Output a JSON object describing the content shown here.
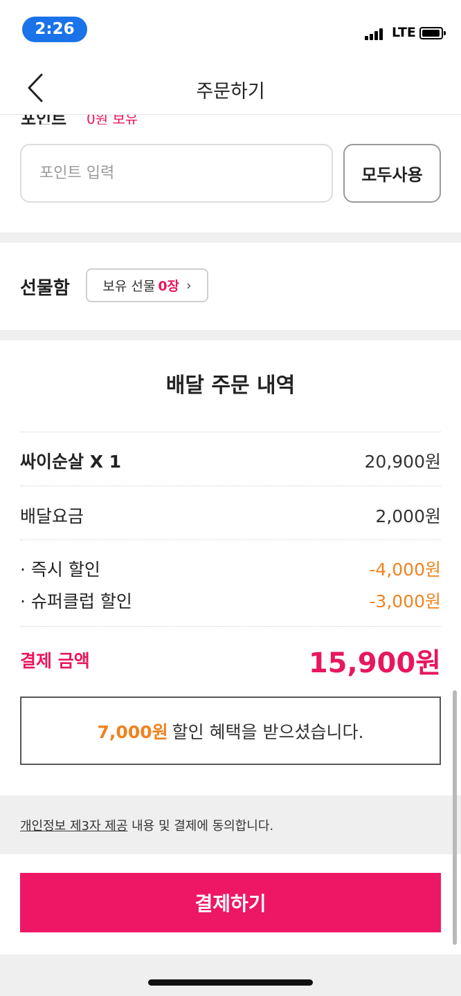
{
  "status_bar": {
    "time": "2:26",
    "network": "LTE"
  },
  "nav": {
    "title": "주문하기"
  },
  "points": {
    "label_partial": "포인트",
    "held_partial": "0원 보유",
    "input_placeholder": "포인트 입력",
    "use_all_label": "모두사용"
  },
  "gift": {
    "label": "선물함",
    "button_prefix": "보유 선물",
    "button_count": "0장",
    "button_chevron": "›"
  },
  "order": {
    "title": "배달 주문 내역",
    "item_name": "싸이순살 X 1",
    "item_price": "20,900원",
    "delivery_label": "배달요금",
    "delivery_fee": "2,000원",
    "discounts": [
      {
        "label": "· 즉시 할인",
        "amount": "-4,000원"
      },
      {
        "label": "· 슈퍼클럽 할인",
        "amount": "-3,000원"
      }
    ],
    "total_label": "결제 금액",
    "total_amount": "15,900원"
  },
  "benefit": {
    "amount": "7,000원",
    "text": "할인 혜택을 받으셨습니다."
  },
  "consent": {
    "link_text": "개인정보 제3자 제공",
    "rest_text": " 내용 및 결제에 동의합니다."
  },
  "pay_button_label": "결제하기",
  "colors": {
    "accent": "#ee1766",
    "discount": "#f0821e",
    "time_pill": "#1a73e8"
  }
}
